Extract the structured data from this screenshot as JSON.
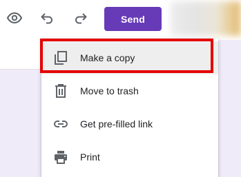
{
  "toolbar": {
    "preview_icon": "eye-icon",
    "undo_icon": "undo-icon",
    "redo_icon": "redo-icon",
    "send_label": "Send",
    "send_color": "#673ab7"
  },
  "menu": {
    "items": [
      {
        "label": "Make a copy",
        "icon": "copy-icon",
        "highlighted": true
      },
      {
        "label": "Move to trash",
        "icon": "trash-icon"
      },
      {
        "label": "Get pre-filled link",
        "icon": "link-icon"
      },
      {
        "label": "Print",
        "icon": "printer-icon"
      }
    ]
  },
  "colors": {
    "highlight_box": "#e50000",
    "page_background": "#f0ebf8"
  }
}
